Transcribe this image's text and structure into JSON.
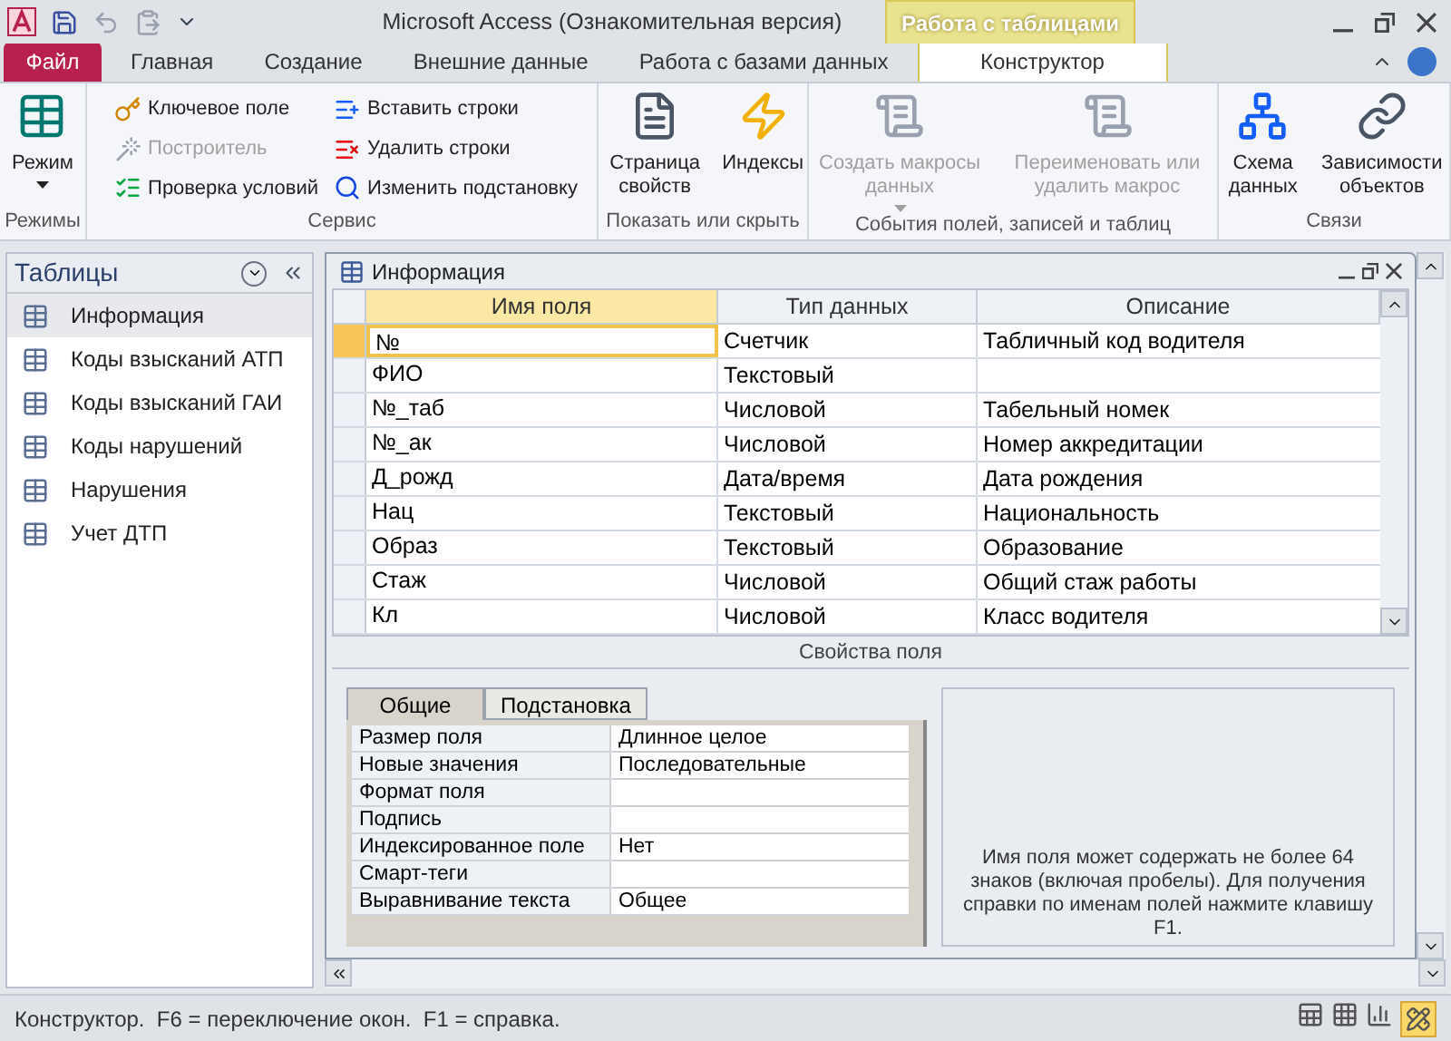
{
  "title_bar": {
    "title": "Microsoft Access (Ознакомительная версия)",
    "context_group": "Работа с таблицами"
  },
  "tabs": [
    {
      "label": "Файл",
      "kind": "file",
      "selected": false
    },
    {
      "label": "Главная",
      "kind": "tab",
      "selected": false
    },
    {
      "label": "Создание",
      "kind": "tab",
      "selected": false
    },
    {
      "label": "Внешние данные",
      "kind": "tab",
      "selected": false
    },
    {
      "label": "Работа с базами данных",
      "kind": "tab",
      "selected": false
    },
    {
      "label": "Конструктор",
      "kind": "context",
      "selected": true
    }
  ],
  "ribbon": {
    "groups": [
      {
        "label": "Режимы",
        "buttons": [
          {
            "label": "Режим",
            "kind": "large",
            "disabled": false,
            "dropdown": true
          }
        ]
      },
      {
        "label": "Сервис",
        "buttons": [
          {
            "label": "Ключевое поле",
            "kind": "small",
            "disabled": false
          },
          {
            "label": "Построитель",
            "kind": "small",
            "disabled": true
          },
          {
            "label": "Проверка условий",
            "kind": "small",
            "disabled": false
          },
          {
            "label": "Вставить строки",
            "kind": "small",
            "disabled": false
          },
          {
            "label": "Удалить строки",
            "kind": "small",
            "disabled": false
          },
          {
            "label": "Изменить подстановку",
            "kind": "small",
            "disabled": false
          }
        ]
      },
      {
        "label": "Показать или скрыть",
        "buttons": [
          {
            "label": "Страница свойств",
            "kind": "large",
            "disabled": false,
            "dropdown": false
          },
          {
            "label": "Индексы",
            "kind": "large",
            "disabled": false,
            "dropdown": false
          }
        ]
      },
      {
        "label": "События полей, записей и таблиц",
        "buttons": [
          {
            "label": "Создать макросы данных",
            "kind": "large",
            "disabled": true,
            "dropdown": true
          },
          {
            "label": "Переименовать или удалить макрос",
            "kind": "large",
            "disabled": true,
            "dropdown": false
          }
        ]
      },
      {
        "label": "Связи",
        "buttons": [
          {
            "label": "Схема данных",
            "kind": "large",
            "disabled": false,
            "dropdown": false
          },
          {
            "label": "Зависимости объектов",
            "kind": "large",
            "disabled": false,
            "dropdown": false
          }
        ]
      }
    ]
  },
  "nav_pane": {
    "title": "Таблицы",
    "items": [
      {
        "label": "Информация",
        "selected": true
      },
      {
        "label": "Коды взысканий АТП",
        "selected": false
      },
      {
        "label": "Коды взысканий ГАИ",
        "selected": false
      },
      {
        "label": "Коды нарушений",
        "selected": false
      },
      {
        "label": "Нарушения",
        "selected": false
      },
      {
        "label": "Учет ДТП",
        "selected": false
      }
    ]
  },
  "table_window": {
    "title": "Информация",
    "columns": [
      "Имя поля",
      "Тип данных",
      "Описание"
    ],
    "rows": [
      {
        "name": "№",
        "type": "Счетчик",
        "description": "Табличный код водителя",
        "selected": true
      },
      {
        "name": "ФИО",
        "type": "Текстовый",
        "selected": false
      },
      {
        "name": "№_таб",
        "type": "Числовой",
        "description": "Табельный номек",
        "selected": false
      },
      {
        "name": "№_ак",
        "type": "Числовой",
        "description": "Номер аккредитации",
        "selected": false
      },
      {
        "name": "Д_рожд",
        "type": "Дата/время",
        "description": "Дата рождения",
        "selected": false
      },
      {
        "name": "Нац",
        "type": "Текстовый",
        "description": "Национальность",
        "selected": false
      },
      {
        "name": "Образ",
        "type": "Текстовый",
        "description": "Образование",
        "selected": false
      },
      {
        "name": "Стаж",
        "type": "Числовой",
        "description": "Общий стаж работы",
        "selected": false
      },
      {
        "name": "Кл",
        "type": "Числовой",
        "description": "Класс водителя",
        "selected": false
      }
    ],
    "properties_label": "Свойства поля",
    "property_tabs": [
      {
        "label": "Общие",
        "selected": true
      },
      {
        "label": "Подстановка",
        "selected": false
      }
    ],
    "properties": [
      {
        "name": "Размер поля",
        "value": "Длинное целое"
      },
      {
        "name": "Новые значения",
        "value": "Последовательные"
      },
      {
        "name": "Формат поля"
      },
      {
        "name": "Подпись"
      },
      {
        "name": "Индексированное поле",
        "value": "Нет"
      },
      {
        "name": "Смарт-теги"
      },
      {
        "name": "Выравнивание текста",
        "value": "Общее"
      }
    ],
    "help_text": "Имя поля может содержать не более 64 знаков (включая пробелы). Для получения справки по именам полей нажмите клавишу F1."
  },
  "status_bar": {
    "text": "Конструктор.  F6 = переключение окон.  F1 = справка."
  }
}
